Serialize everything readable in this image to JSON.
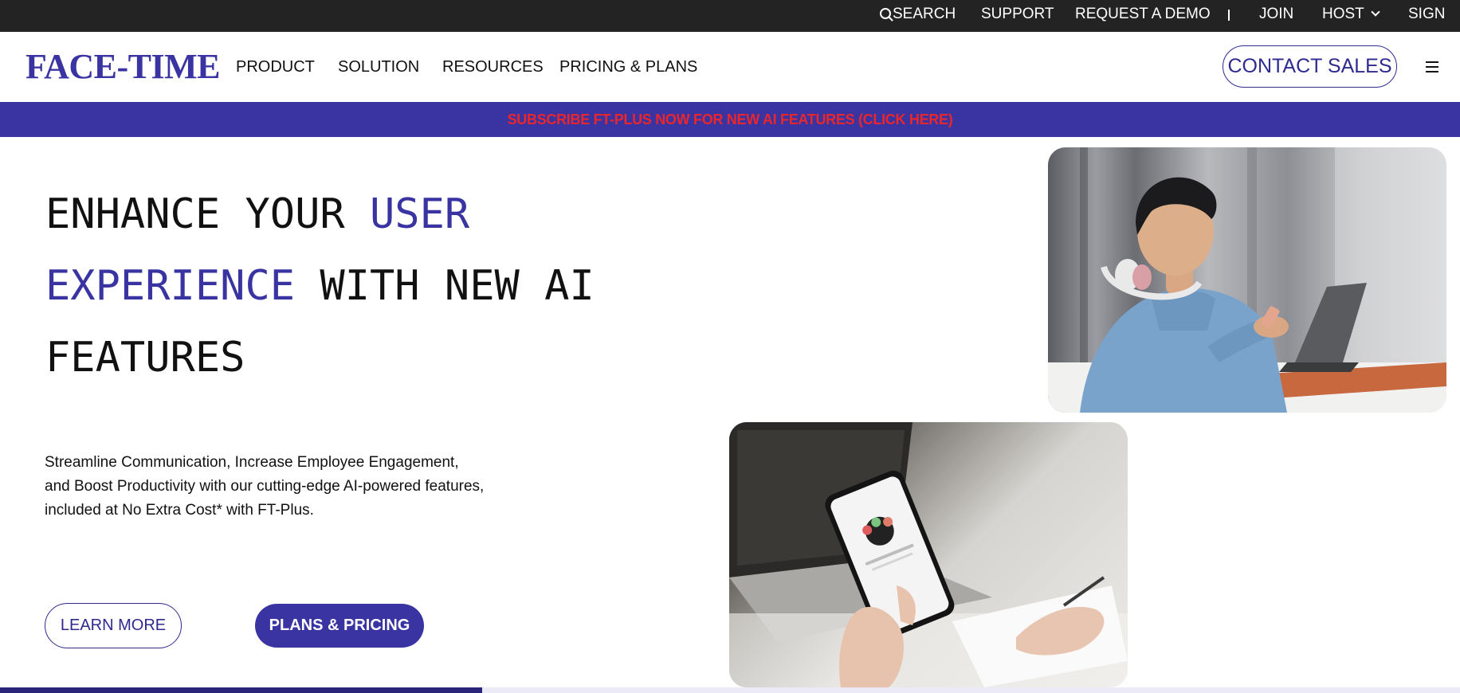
{
  "topbar": {
    "search": "SEARCH",
    "support": "SUPPORT",
    "request_demo": "REQUEST A DEMO",
    "join": "JOIN",
    "host": "HOST",
    "sign": "SIGN"
  },
  "nav": {
    "logo": "FACE-TIME",
    "links": [
      "PRODUCT",
      "SOLUTION",
      "RESOURCES",
      "PRICING & PLANS"
    ],
    "contact_sales": "CONTACT SALES"
  },
  "banner": {
    "text": "SUBSCRIBE FT-PLUS NOW FOR NEW AI FEATURES (CLICK HERE)"
  },
  "hero": {
    "title_part1": "ENHANCE YOUR ",
    "title_accent1": "USER",
    "title_accent2": "EXPERIENCE",
    "title_part2": " WITH NEW AI",
    "title_part3": "FEATURES",
    "sub_line1": "Streamline Communication, Increase Employee Engagement,",
    "sub_line2": "and Boost Productivity with our cutting-edge AI-powered features,",
    "sub_line3": "included at No Extra Cost* with FT-Plus.",
    "learn_more": "LEARN MORE",
    "plans_pricing": "PLANS & PRICING"
  },
  "progress": {
    "value": 0.33
  },
  "colors": {
    "brand": "#3a34a3",
    "topbar_bg": "#232323",
    "banner_text": "#e8262c"
  }
}
